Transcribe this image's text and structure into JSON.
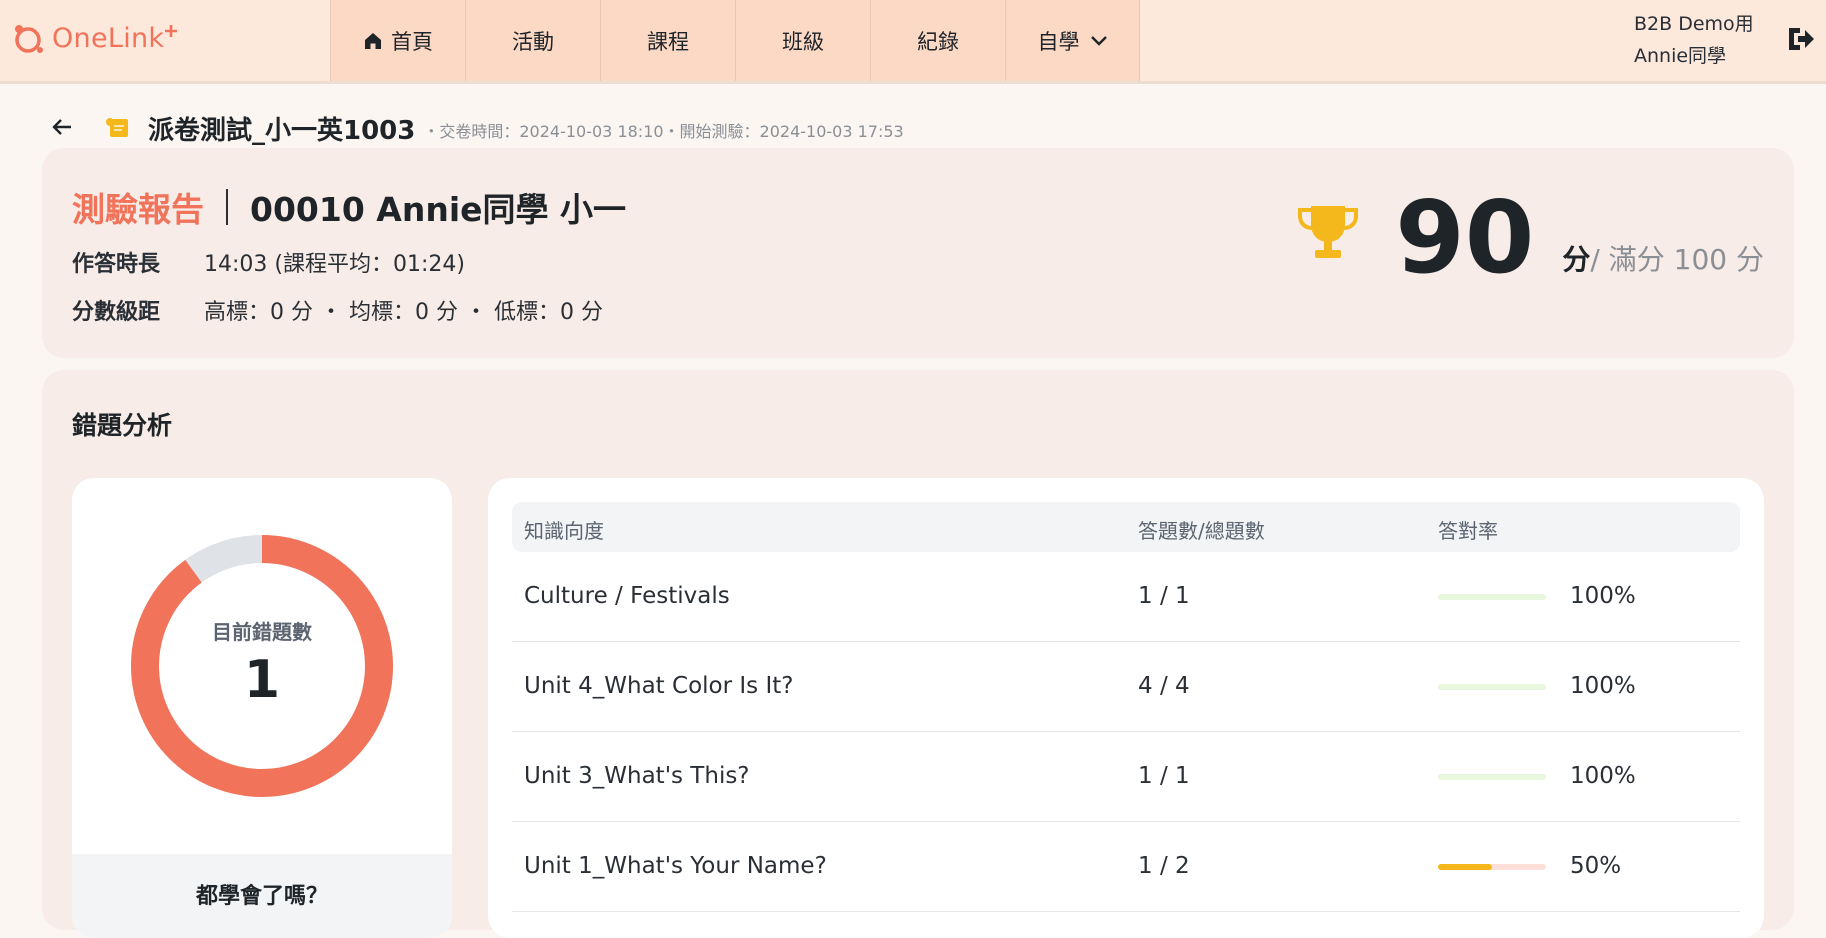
{
  "header": {
    "logo_text": "OneLink",
    "nav": [
      {
        "label": "首頁",
        "icon": "home-icon"
      },
      {
        "label": "活動"
      },
      {
        "label": "課程"
      },
      {
        "label": "班級"
      },
      {
        "label": "紀錄"
      },
      {
        "label": "自學",
        "icon": "chevron-down-icon"
      }
    ],
    "user_line1": "B2B Demo用",
    "user_line2": "Annie同學",
    "logout_icon": "logout-icon"
  },
  "title": {
    "exam_name": "派卷測試_小一英1003",
    "meta": "・交卷時間：2024-10-03 18:10・開始測驗：2024-10-03 17:53"
  },
  "report": {
    "label": "測驗報告",
    "student": "00010 Annie同學 小一",
    "duration_key": "作答時長",
    "duration_value": "14:03 (課程平均：01:24)",
    "range_key": "分數級距",
    "range_value": "高標：0 分 ・ 均標：0 分 ・ 低標：0 分",
    "score": "90",
    "score_unit": "分",
    "score_full": "/ 滿分 100 分"
  },
  "analysis": {
    "title": "錯題分析",
    "donut_label": "目前錯題數",
    "donut_value": "1",
    "donut_wrong_fraction": 0.9,
    "donut_footer": "都學會了嗎？",
    "columns": [
      "知識向度",
      "答題數/總題數",
      "答對率"
    ],
    "rows": [
      {
        "topic": "Culture / Festivals",
        "count": "1 / 1",
        "rate": "100%",
        "fraction": 1.0
      },
      {
        "topic": "Unit 4_What Color Is It?",
        "count": "4 / 4",
        "rate": "100%",
        "fraction": 1.0
      },
      {
        "topic": "Unit 3_What's This?",
        "count": "1 / 1",
        "rate": "100%",
        "fraction": 1.0
      },
      {
        "topic": "Unit 1_What's Your Name?",
        "count": "1 / 2",
        "rate": "50%",
        "fraction": 0.5
      }
    ]
  },
  "colors": {
    "accent": "#f0735a",
    "nav_bg": "#fbd9c5",
    "trophy": "#f5b81c",
    "bar_full": "#e9f7df",
    "bar_half_fill": "#f5b81c",
    "bar_half_track": "#fde0da",
    "donut_rest": "#dfe2e6"
  }
}
